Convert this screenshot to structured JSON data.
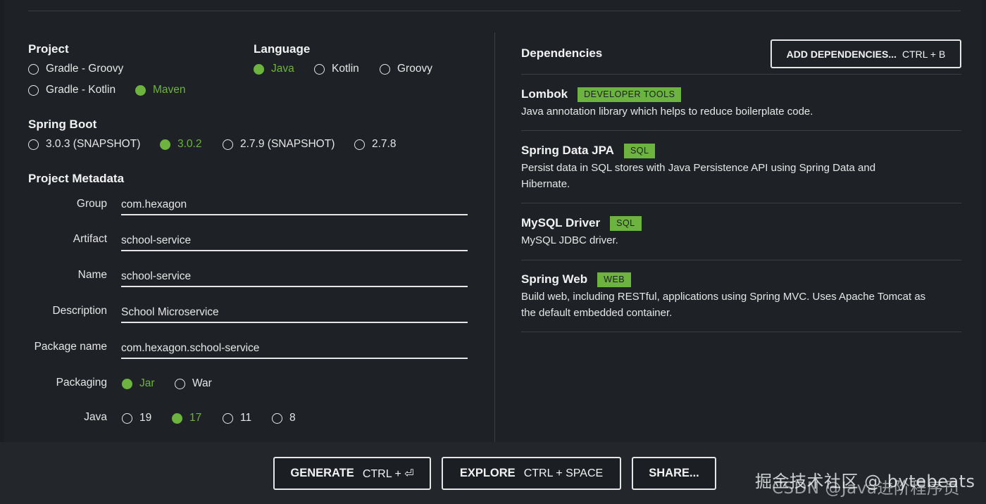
{
  "project": {
    "title": "Project",
    "options": [
      {
        "label": "Gradle - Groovy",
        "selected": false
      },
      {
        "label": "Gradle - Kotlin",
        "selected": false
      },
      {
        "label": "Maven",
        "selected": true
      }
    ]
  },
  "language": {
    "title": "Language",
    "options": [
      {
        "label": "Java",
        "selected": true
      },
      {
        "label": "Kotlin",
        "selected": false
      },
      {
        "label": "Groovy",
        "selected": false
      }
    ]
  },
  "spring_boot": {
    "title": "Spring Boot",
    "options": [
      {
        "label": "3.0.3 (SNAPSHOT)",
        "selected": false
      },
      {
        "label": "3.0.2",
        "selected": true
      },
      {
        "label": "2.7.9 (SNAPSHOT)",
        "selected": false
      },
      {
        "label": "2.7.8",
        "selected": false
      }
    ]
  },
  "metadata": {
    "title": "Project Metadata",
    "fields": [
      {
        "label": "Group",
        "value": "com.hexagon"
      },
      {
        "label": "Artifact",
        "value": "school-service"
      },
      {
        "label": "Name",
        "value": "school-service"
      },
      {
        "label": "Description",
        "value": "School Microservice"
      },
      {
        "label": "Package name",
        "value": "com.hexagon.school-service"
      }
    ],
    "packaging": {
      "label": "Packaging",
      "options": [
        {
          "label": "Jar",
          "selected": true
        },
        {
          "label": "War",
          "selected": false
        }
      ]
    },
    "java": {
      "label": "Java",
      "options": [
        {
          "label": "19",
          "selected": false
        },
        {
          "label": "17",
          "selected": true
        },
        {
          "label": "11",
          "selected": false
        },
        {
          "label": "8",
          "selected": false
        }
      ]
    }
  },
  "dependencies": {
    "title": "Dependencies",
    "add_button": {
      "label": "ADD DEPENDENCIES...",
      "shortcut": "CTRL + B"
    },
    "items": [
      {
        "name": "Lombok",
        "tag": "DEVELOPER TOOLS",
        "description": "Java annotation library which helps to reduce boilerplate code."
      },
      {
        "name": "Spring Data JPA",
        "tag": "SQL",
        "description": "Persist data in SQL stores with Java Persistence API using Spring Data and Hibernate."
      },
      {
        "name": "MySQL Driver",
        "tag": "SQL",
        "description": "MySQL JDBC driver."
      },
      {
        "name": "Spring Web",
        "tag": "WEB",
        "description": "Build web, including RESTful, applications using Spring MVC. Uses Apache Tomcat as the default embedded container."
      }
    ]
  },
  "footer": {
    "generate": {
      "label": "GENERATE",
      "shortcut": "CTRL + ⏎"
    },
    "explore": {
      "label": "EXPLORE",
      "shortcut": "CTRL + SPACE"
    },
    "share": {
      "label": "SHARE..."
    }
  },
  "watermark": {
    "line1": "掘金技术社区 @ bytebeats",
    "line2": "CSDN @Java进阶程序员"
  },
  "colors": {
    "accent": "#6db33f",
    "background": "#1e2226"
  }
}
